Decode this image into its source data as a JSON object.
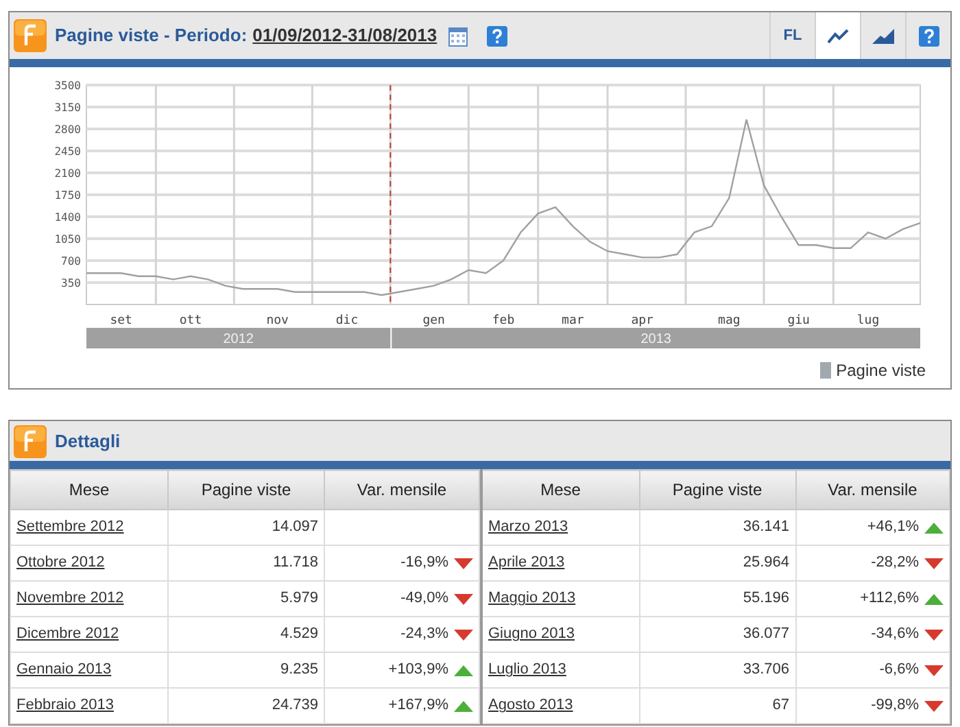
{
  "chart_panel": {
    "title": "Pagine viste - Periodo:",
    "period": "01/09/2012-31/08/2013",
    "toolbar": [
      {
        "kind": "text",
        "label": "FL",
        "selected": false
      },
      {
        "kind": "line",
        "selected": true
      },
      {
        "kind": "area",
        "selected": false
      },
      {
        "kind": "help",
        "selected": false
      }
    ],
    "year_bands": [
      "2012",
      "2013"
    ],
    "chart_data": {
      "type": "line",
      "ylim": [
        0,
        3500
      ],
      "grid": true,
      "yticks": [
        350,
        700,
        1050,
        1400,
        1750,
        2100,
        2450,
        2800,
        3150,
        3500
      ],
      "categories": [
        null,
        null,
        "set",
        null,
        null,
        null,
        "ott",
        null,
        null,
        null,
        null,
        "nov",
        null,
        null,
        null,
        "dic",
        null,
        null,
        null,
        null,
        "gen",
        null,
        null,
        null,
        "feb",
        null,
        null,
        null,
        "mar",
        null,
        null,
        null,
        "apr",
        null,
        null,
        null,
        null,
        "mag",
        null,
        null,
        null,
        "giu",
        null,
        null,
        null,
        "lug",
        null,
        null,
        null
      ],
      "series": [
        {
          "name": "Pagine viste",
          "color": "#a0a0a0",
          "values": [
            500,
            500,
            500,
            450,
            450,
            400,
            450,
            400,
            300,
            250,
            250,
            250,
            200,
            200,
            200,
            200,
            200,
            150,
            200,
            250,
            300,
            400,
            550,
            500,
            700,
            1150,
            1450,
            1550,
            1250,
            1000,
            850,
            800,
            750,
            750,
            800,
            1150,
            1250,
            1700,
            2950,
            1900,
            1400,
            950,
            950,
            900,
            900,
            1150,
            1050,
            1200,
            1300
          ]
        }
      ]
    }
  },
  "details_panel": {
    "title": "Dettagli",
    "columns": [
      "Mese",
      "Pagine viste",
      "Var. mensile",
      "Mese",
      "Pagine viste",
      "Var. mensile"
    ],
    "rows": [
      {
        "month": "Settembre 2012",
        "views": "14.097"
      },
      {
        "month": "Ottobre 2012",
        "views": "11.718",
        "change": "-16,9%",
        "kind": "down"
      },
      {
        "month": "Novembre 2012",
        "views": "5.979",
        "change": "-49,0%",
        "kind": "down"
      },
      {
        "month": "Dicembre 2012",
        "views": "4.529",
        "change": "-24,3%",
        "kind": "down"
      },
      {
        "month": "Gennaio 2013",
        "views": "9.235",
        "change": "+103,9%",
        "kind": "up"
      },
      {
        "month": "Febbraio 2013",
        "views": "24.739",
        "change": "+167,9%",
        "kind": "up"
      },
      {
        "month": "Marzo 2013",
        "views": "36.141",
        "change": "+46,1%",
        "kind": "up"
      },
      {
        "month": "Aprile 2013",
        "views": "25.964",
        "change": "-28,2%",
        "kind": "down"
      },
      {
        "month": "Maggio 2013",
        "views": "55.196",
        "change": "+112,6%",
        "kind": "up"
      },
      {
        "month": "Giugno 2013",
        "views": "36.077",
        "change": "-34,6%",
        "kind": "down"
      },
      {
        "month": "Luglio 2013",
        "views": "33.706",
        "change": "-6,6%",
        "kind": "down"
      },
      {
        "month": "Agosto 2013",
        "views": "67",
        "change": "-99,8%",
        "kind": "down"
      }
    ]
  }
}
